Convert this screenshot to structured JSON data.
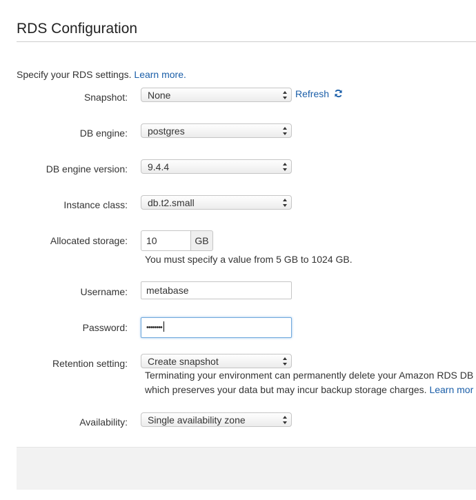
{
  "page": {
    "title": "RDS Configuration"
  },
  "intro": {
    "text": "Specify your RDS settings.",
    "link": "Learn more."
  },
  "fields": {
    "snapshot": {
      "label": "Snapshot:",
      "value": "None",
      "refresh_label": "Refresh"
    },
    "db_engine": {
      "label": "DB engine:",
      "value": "postgres"
    },
    "db_engine_version": {
      "label": "DB engine version:",
      "value": "9.4.4"
    },
    "instance_class": {
      "label": "Instance class:",
      "value": "db.t2.small"
    },
    "allocated_storage": {
      "label": "Allocated storage:",
      "value": "10",
      "unit": "GB",
      "help": "You must specify a value from 5 GB to 1024 GB."
    },
    "username": {
      "label": "Username:",
      "value": "metabase"
    },
    "password": {
      "label": "Password:",
      "value": "••••••••"
    },
    "retention": {
      "label": "Retention setting:",
      "value": "Create snapshot",
      "help_line1": "Terminating your environment can permanently delete your Amazon RDS DB",
      "help_line2": "which preserves your data but may incur backup storage charges.",
      "help_link": "Learn mor"
    },
    "availability": {
      "label": "Availability:",
      "value": "Single availability zone"
    }
  },
  "icons": {
    "refresh": "refresh-icon",
    "select_arrows": "chevron-updown-icon"
  },
  "colors": {
    "link": "#1a5ea8",
    "focus_border": "#6fa8dc",
    "panel_bg": "#f2f2f2"
  }
}
